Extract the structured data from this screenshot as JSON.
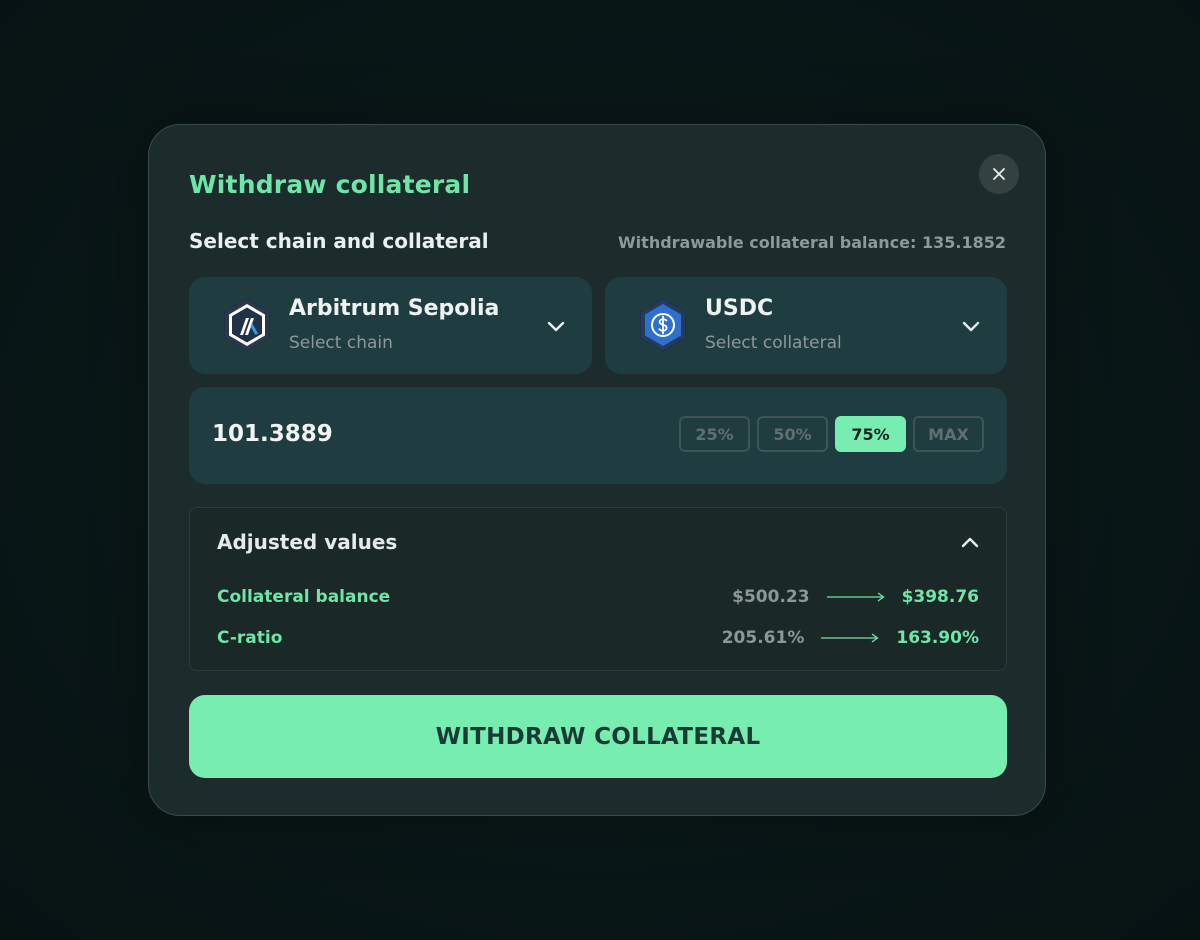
{
  "modal": {
    "title": "Withdraw collateral",
    "close_icon": "close-icon"
  },
  "selection": {
    "label": "Select chain and collateral",
    "balance_text": "Withdrawable collateral balance: 135.1852"
  },
  "chain": {
    "name": "Arbitrum Sepolia",
    "hint": "Select chain",
    "icon": "arbitrum-icon"
  },
  "collateral": {
    "name": "USDC",
    "hint": "Select collateral",
    "icon": "usdc-icon"
  },
  "amount": {
    "value": "101.3889",
    "percent_options": [
      "25%",
      "50%",
      "75%",
      "MAX"
    ],
    "selected_option": "75%"
  },
  "adjusted": {
    "title": "Adjusted values",
    "expanded": true,
    "rows": [
      {
        "label": "Collateral balance",
        "from": "$500.23",
        "to": "$398.76"
      },
      {
        "label": "C-ratio",
        "from": "205.61%",
        "to": "163.90%"
      }
    ]
  },
  "submit": {
    "label": "WITHDRAW COLLATERAL"
  },
  "colors": {
    "accent": "#77eeb0",
    "title_green": "#6fe5a6",
    "panel": "#1c2b2b",
    "field": "#1f3c40",
    "background": "#0a1818"
  }
}
